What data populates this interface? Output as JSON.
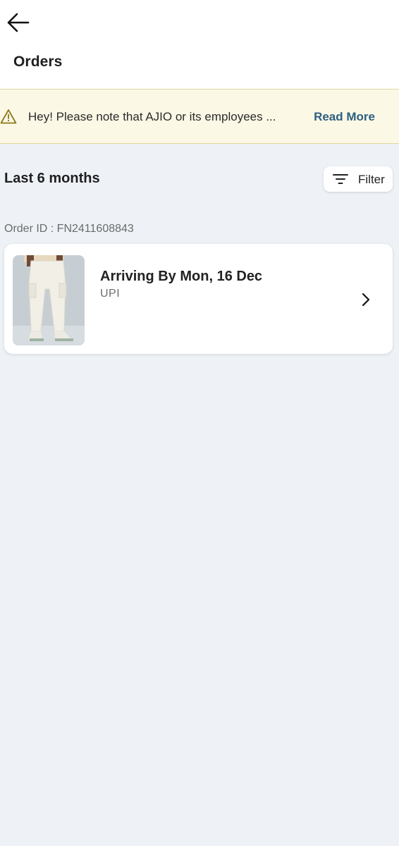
{
  "header": {
    "title": "Orders",
    "back_icon": "arrow-left-icon"
  },
  "notice": {
    "icon": "warning-icon",
    "text": "Hey! Please note that AJIO or its employees ...",
    "link_label": "Read More",
    "background": "#fbf8e6",
    "border": "#e2d79a",
    "link_color": "#2e5f7f"
  },
  "orders_section": {
    "range_label": "Last 6 months",
    "filter_label": "Filter",
    "filter_icon": "filter-lines-icon"
  },
  "orders": [
    {
      "order_id_label": "Order ID : FN2411608843",
      "status": "Arriving By Mon, 16 Dec",
      "payment": "UPI",
      "thumbnail": "product-image-white-cargo-pants",
      "chevron_icon": "chevron-right-icon"
    }
  ],
  "colors": {
    "page_background": "#eef2f6",
    "card_background": "#ffffff"
  }
}
